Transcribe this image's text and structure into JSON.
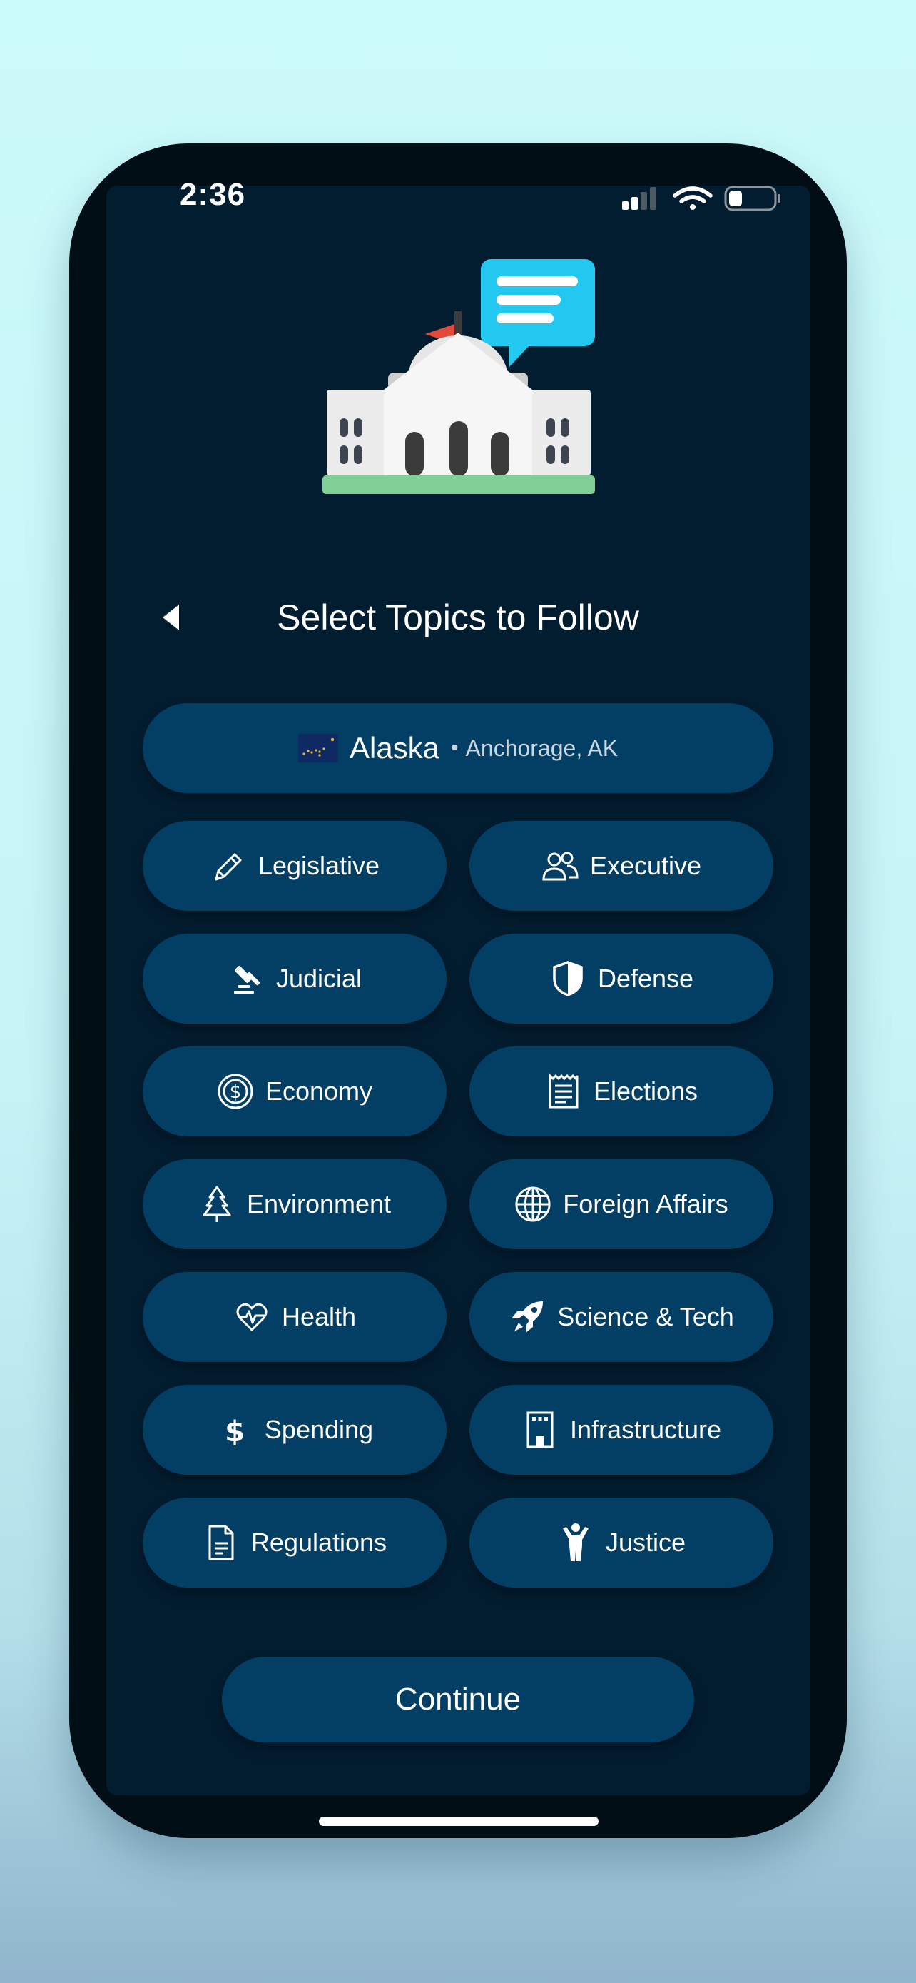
{
  "status_bar": {
    "time": "2:36"
  },
  "header": {
    "title": "Select Topics to Follow",
    "back_icon": "back-arrow-icon"
  },
  "location": {
    "state": "Alaska",
    "city": "Anchorage, AK",
    "separator": "•",
    "flag_icon": "alaska-flag-icon"
  },
  "topics": [
    {
      "label": "Legislative",
      "icon": "pencil-icon"
    },
    {
      "label": "Executive",
      "icon": "people-icon"
    },
    {
      "label": "Judicial",
      "icon": "gavel-icon"
    },
    {
      "label": "Defense",
      "icon": "shield-icon"
    },
    {
      "label": "Economy",
      "icon": "dollar-coin-icon"
    },
    {
      "label": "Elections",
      "icon": "ballot-icon"
    },
    {
      "label": "Environment",
      "icon": "tree-icon"
    },
    {
      "label": "Foreign Affairs",
      "icon": "globe-icon"
    },
    {
      "label": "Health",
      "icon": "heartbeat-icon"
    },
    {
      "label": "Science & Tech",
      "icon": "rocket-icon"
    },
    {
      "label": "Spending",
      "icon": "dollar-icon"
    },
    {
      "label": "Infrastructure",
      "icon": "building-icon"
    },
    {
      "label": "Regulations",
      "icon": "document-icon"
    },
    {
      "label": "Justice",
      "icon": "person-icon"
    }
  ],
  "continue_label": "Continue",
  "colors": {
    "background": "#031d30",
    "pill": "#033f64",
    "accent": "#22c8f0",
    "flag": "#e24a3b",
    "ground": "#7fcf96"
  }
}
